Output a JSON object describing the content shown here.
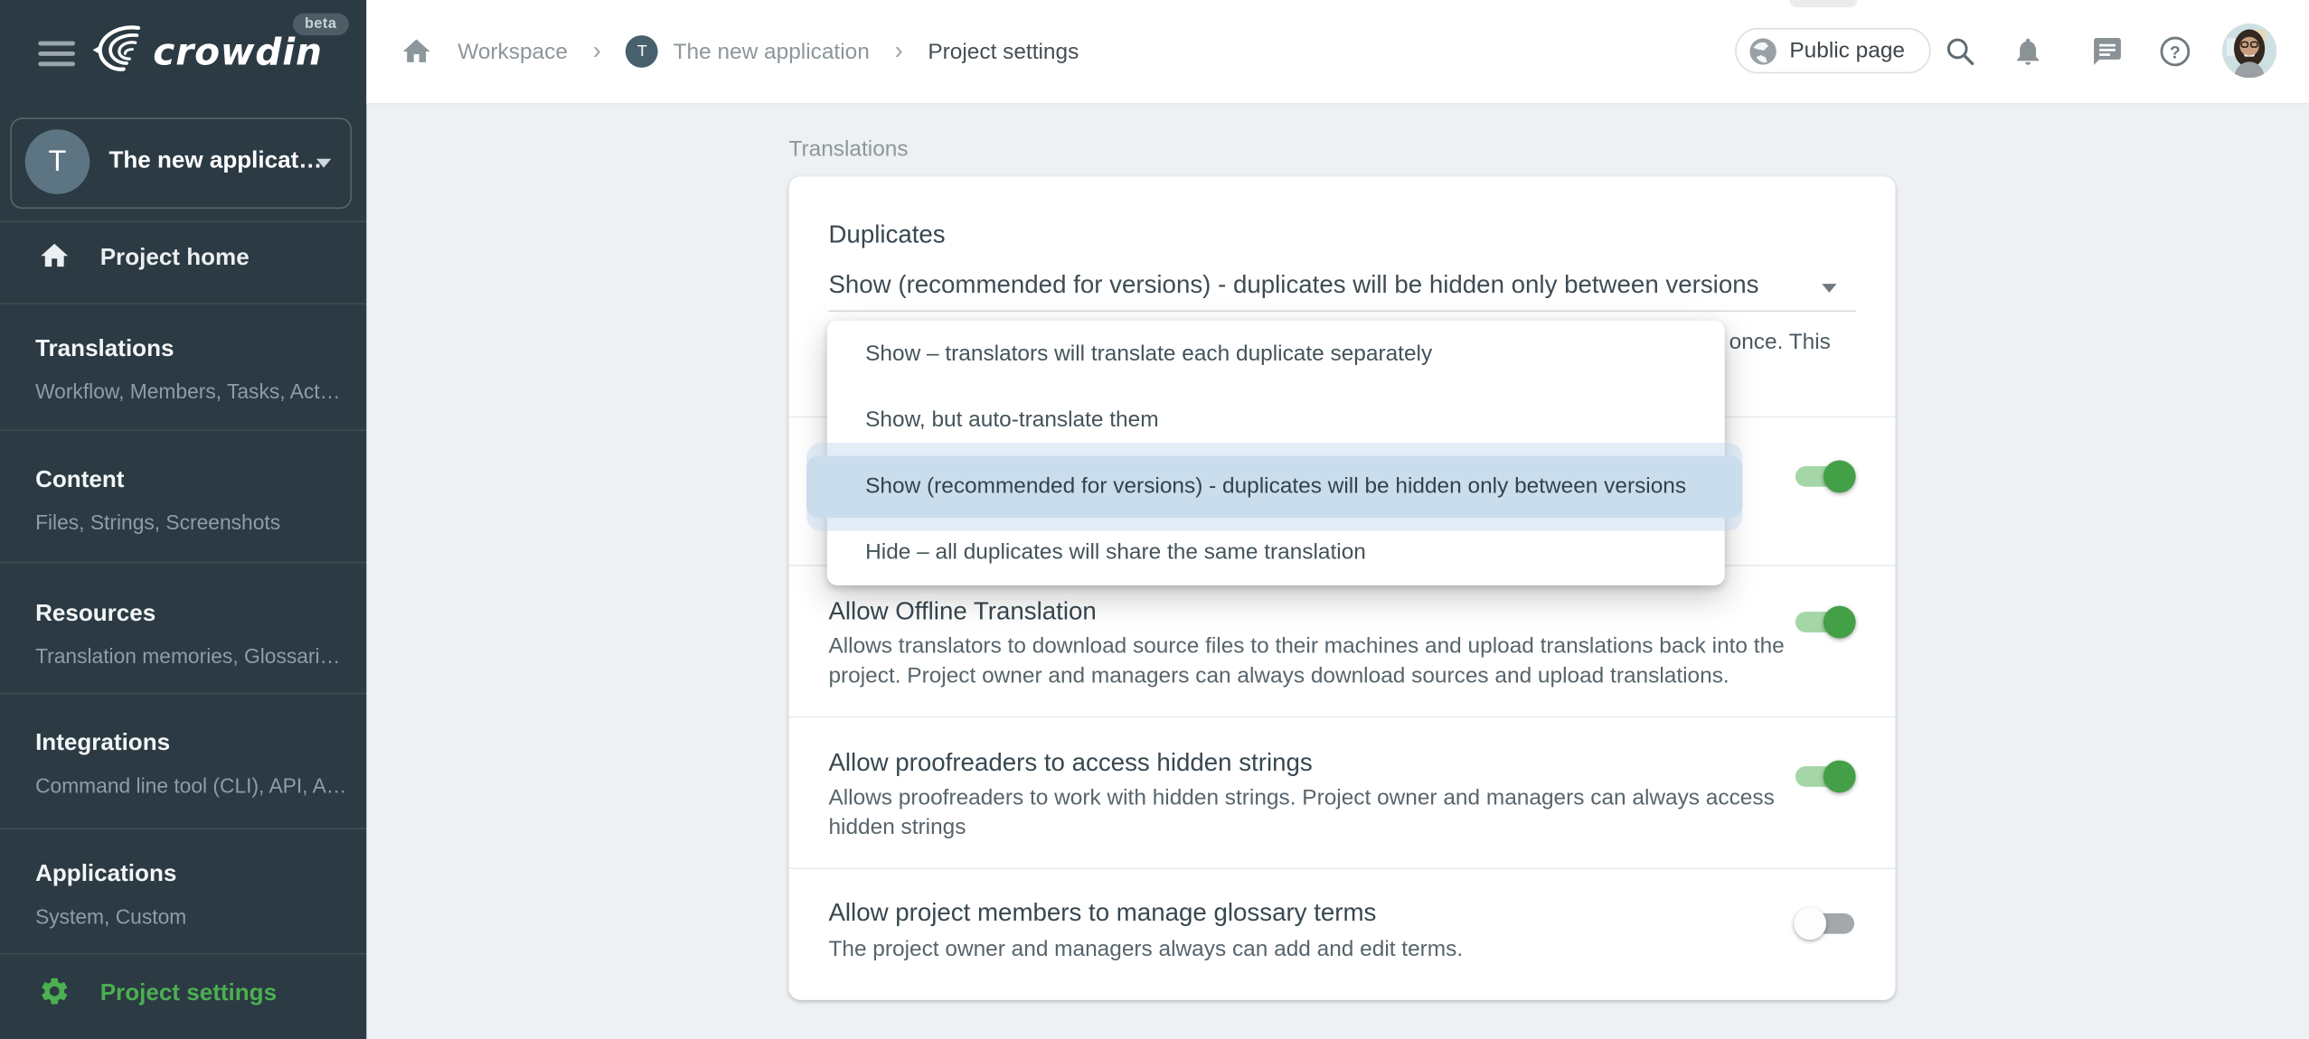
{
  "app": {
    "name": "crowdin",
    "beta_badge": "beta"
  },
  "topbar": {
    "breadcrumb": {
      "separator": "›",
      "project_chip_initial": "T",
      "items": [
        "Workspace",
        "The new application",
        "Project settings"
      ]
    },
    "public_page_button": "Public page"
  },
  "sidebar": {
    "project_switcher": {
      "initial": "T",
      "label": "The new applicat…"
    },
    "project_home": "Project home",
    "sections": [
      {
        "title": "Translations",
        "subtitle": "Workflow, Members, Tasks, Act…"
      },
      {
        "title": "Content",
        "subtitle": "Files, Strings, Screenshots"
      },
      {
        "title": "Resources",
        "subtitle": "Translation memories, Glossari…"
      },
      {
        "title": "Integrations",
        "subtitle": "Command line tool (CLI), API, A…"
      },
      {
        "title": "Applications",
        "subtitle": "System, Custom"
      }
    ],
    "project_settings": "Project settings"
  },
  "main": {
    "page_label": "Translations",
    "card": {
      "duplicates_title": "Duplicates",
      "select_value": "Show (recommended for versions) - duplicates will be hidden only between versions",
      "description_visible_fragment": "once. This",
      "dropdown_options": [
        "Show – translators will translate each duplicate separately",
        "Show, but auto-translate them",
        "Show (recommended for versions) - duplicates will be hidden only between versions",
        "Hide – all duplicates will share the same translation"
      ],
      "dropdown_selected_index": 2,
      "rows": [
        {
          "title": "",
          "description": "",
          "enabled": true
        },
        {
          "title": "Allow Offline Translation",
          "description": "Allows translators to download source files to their machines and upload translations back into the project. Project owner and managers can always download sources and upload translations.",
          "enabled": true
        },
        {
          "title": "Allow proofreaders to access hidden strings",
          "description": "Allows proofreaders to work with hidden strings. Project owner and managers can always access hidden strings",
          "enabled": true
        },
        {
          "title": "Allow project members to manage glossary terms",
          "description": "The project owner and managers always can add and edit terms.",
          "enabled": false
        }
      ]
    }
  },
  "colors": {
    "accent_green": "#4caf50",
    "toggle_on_knob": "#43a047",
    "toggle_on_track": "#a5d6a7",
    "toggle_off_track": "#a3a8ab",
    "sidebar_bg": "#2b3a43",
    "menu_highlight_inner": "#cadded",
    "menu_highlight_outer": "#dce8f5"
  }
}
